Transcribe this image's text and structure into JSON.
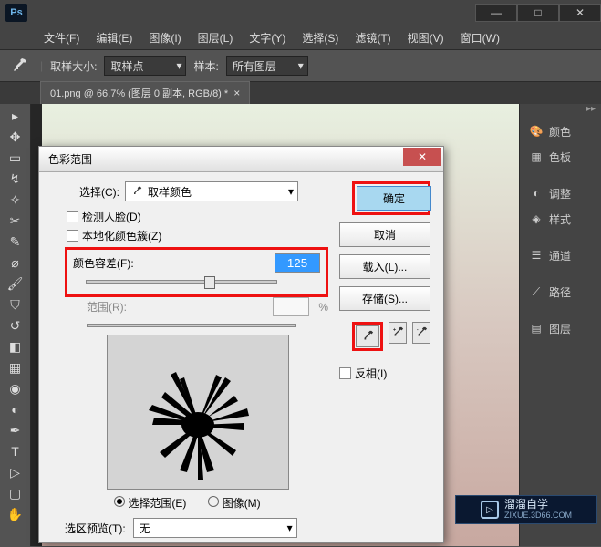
{
  "window": {
    "minimize": "—",
    "maximize": "□",
    "close": "✕"
  },
  "menu": {
    "file": "文件(F)",
    "edit": "编辑(E)",
    "image": "图像(I)",
    "layer": "图层(L)",
    "type": "文字(Y)",
    "select": "选择(S)",
    "filter": "滤镜(T)",
    "view": "视图(V)",
    "window": "窗口(W)"
  },
  "options": {
    "sample_size_label": "取样大小:",
    "sample_size_value": "取样点",
    "sample_label": "样本:",
    "sample_value": "所有图层"
  },
  "tab": {
    "label": "01.png @ 66.7% (图层 0 副本, RGB/8) *",
    "close": "×"
  },
  "panels": {
    "color": "颜色",
    "swatches": "色板",
    "adjustments": "调整",
    "styles": "样式",
    "channels": "通道",
    "paths": "路径",
    "layers": "图层"
  },
  "dialog": {
    "title": "色彩范围",
    "close": "✕",
    "select_label": "选择(C):",
    "select_value": "取样颜色",
    "detect_faces": "检测人脸(D)",
    "localized": "本地化颜色簇(Z)",
    "fuzziness_label": "颜色容差(F):",
    "fuzziness_value": "125",
    "range_label": "范围(R):",
    "range_unit": "%",
    "radio_selection": "选择范围(E)",
    "radio_image": "图像(M)",
    "preview_label": "选区预览(T):",
    "preview_value": "无",
    "ok": "确定",
    "cancel": "取消",
    "load": "载入(L)...",
    "save": "存储(S)...",
    "invert": "反相(I)"
  },
  "watermark": {
    "brand": "溜溜自学",
    "url": "ZIXUE.3D66.COM"
  }
}
